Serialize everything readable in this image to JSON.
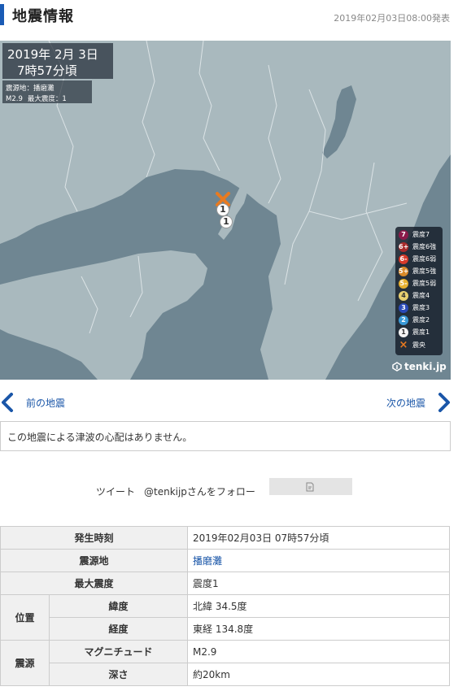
{
  "header": {
    "title": "地震情報",
    "published": "2019年02月03日08:00発表"
  },
  "map": {
    "date": "2019年  2月  3日",
    "time": "7時57分頃",
    "epicenter_label": "震源地：播磨灘",
    "magnitude_label": "M2.9",
    "max_intensity_label": "最大震度：1",
    "observed_intensity": "1",
    "legend": [
      {
        "mark": "7",
        "label": "震度7",
        "color": "#8b1a4a"
      },
      {
        "mark": "6+",
        "label": "震度6強",
        "color": "#a82a2a"
      },
      {
        "mark": "6-",
        "label": "震度6弱",
        "color": "#d63a2a"
      },
      {
        "mark": "5+",
        "label": "震度5強",
        "color": "#d88a2a"
      },
      {
        "mark": "5-",
        "label": "震度5弱",
        "color": "#e6b030"
      },
      {
        "mark": "4",
        "label": "震度4",
        "color": "#e8d070"
      },
      {
        "mark": "3",
        "label": "震度3",
        "color": "#2a4ab8"
      },
      {
        "mark": "2",
        "label": "震度2",
        "color": "#3a9ad8"
      },
      {
        "mark": "1",
        "label": "震度1",
        "color": "#f4f4f4"
      },
      {
        "mark": "×",
        "label": "震央",
        "color": "#e87a20"
      }
    ],
    "brand": "tenki.jp"
  },
  "nav": {
    "prev_label": "前の地震",
    "next_label": "次の地震"
  },
  "tsunami": {
    "message": "この地震による津波の心配はありません。"
  },
  "social": {
    "tweet_label": "ツイート",
    "follow_label": "@tenkijpさんをフォロー"
  },
  "details": {
    "occurred_label": "発生時刻",
    "occurred_value": "2019年02月03日 07時57分頃",
    "epicenter_label": "震源地",
    "epicenter_value": "播磨灘",
    "max_intensity_label": "最大震度",
    "max_intensity_value": "震度1",
    "position_label": "位置",
    "latitude_label": "緯度",
    "latitude_value": "北緯 34.5度",
    "longitude_label": "経度",
    "longitude_value": "東経 134.8度",
    "hypocenter_label": "震源",
    "magnitude_label": "マグニチュード",
    "magnitude_value": "M2.9",
    "depth_label": "深さ",
    "depth_value": "約20km"
  }
}
